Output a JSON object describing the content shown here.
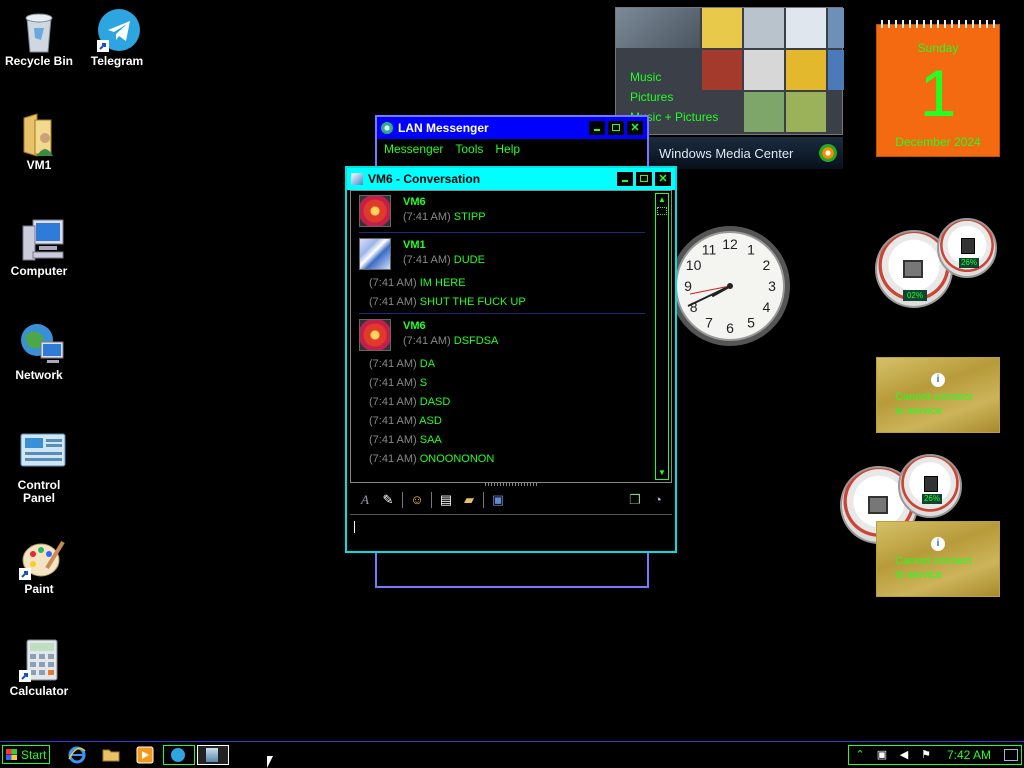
{
  "desktop_icons": [
    {
      "label": "Recycle Bin",
      "icon": "recycle-bin-icon"
    },
    {
      "label": "Telegram",
      "icon": "telegram-icon"
    },
    {
      "label": "VM1",
      "icon": "user-folder-icon"
    },
    {
      "label": "Computer",
      "icon": "computer-icon"
    },
    {
      "label": "Network",
      "icon": "network-icon"
    },
    {
      "label": "Control Panel",
      "icon": "control-panel-icon"
    },
    {
      "label": "Paint",
      "icon": "paint-icon"
    },
    {
      "label": "Calculator",
      "icon": "calculator-icon"
    }
  ],
  "lan_window": {
    "title": "LAN Messenger",
    "menu": [
      "Messenger",
      "Tools",
      "Help"
    ]
  },
  "conversation": {
    "title": "VM6 - Conversation",
    "groups": [
      {
        "sender": "VM6",
        "avatar": "flower",
        "messages": [
          {
            "time": "(7:41 AM)",
            "text": "STIPP"
          }
        ]
      },
      {
        "sender": "VM1",
        "avatar": "art",
        "messages": [
          {
            "time": "(7:41 AM)",
            "text": "DUDE"
          },
          {
            "time": "(7:41 AM)",
            "text": "IM HERE"
          },
          {
            "time": "(7:41 AM)",
            "text": "SHUT THE FUCK UP"
          }
        ]
      },
      {
        "sender": "VM6",
        "avatar": "flower",
        "messages": [
          {
            "time": "(7:41 AM)",
            "text": "DSFDSA"
          },
          {
            "time": "(7:41 AM)",
            "text": "DA"
          },
          {
            "time": "(7:41 AM)",
            "text": "S"
          },
          {
            "time": "(7:41 AM)",
            "text": "DASD"
          },
          {
            "time": "(7:41 AM)",
            "text": "ASD"
          },
          {
            "time": "(7:41 AM)",
            "text": "SAA"
          },
          {
            "time": "(7:41 AM)",
            "text": "ONOONONON"
          }
        ]
      }
    ],
    "input_value": ""
  },
  "media_center": {
    "menu": [
      "Music",
      "Pictures",
      "Music + Pictures"
    ],
    "brand": "Windows Media Center"
  },
  "calendar": {
    "weekday": "Sunday",
    "day": "1",
    "month_year": "December 2024"
  },
  "clock_gadget": {
    "hour_numbers": [
      "12",
      "1",
      "2",
      "3",
      "4",
      "5",
      "6",
      "7",
      "8",
      "9",
      "10",
      "11"
    ]
  },
  "cpu_meters": [
    {
      "left_value": "02%",
      "right_value": "26%"
    },
    {
      "left_value": "",
      "right_value": "26%"
    }
  ],
  "feed_gadgets": [
    {
      "message_line1": "Cannot connect",
      "message_line2": "to service"
    },
    {
      "message_line1": "Cannot connect",
      "message_line2": "to service"
    }
  ],
  "taskbar": {
    "start_label": "Start",
    "clock": "7:42 AM",
    "quick_launch": [
      "internet-explorer-icon",
      "explorer-folder-icon",
      "media-player-icon"
    ],
    "running": [
      "telegram-icon",
      "lan-messenger-icon"
    ]
  },
  "colors": {
    "accent_green": "#22ff22",
    "title_cyan": "#00ffff",
    "title_blue": "#0000ff",
    "calendar_orange": "#f36a10"
  }
}
